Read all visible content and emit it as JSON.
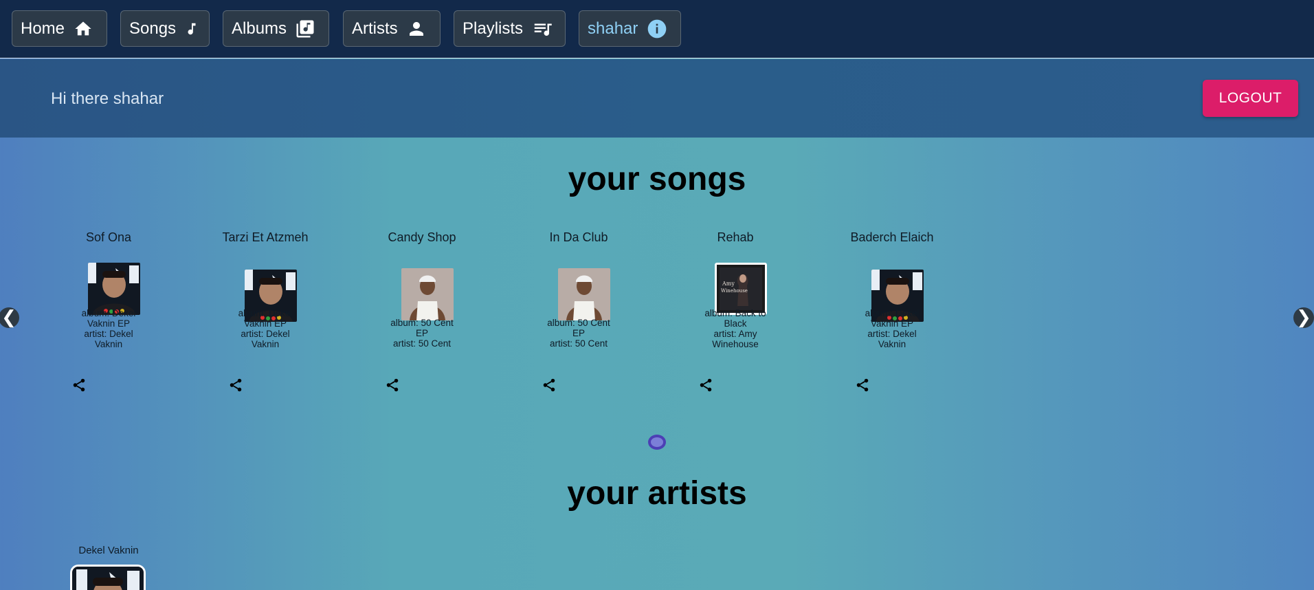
{
  "nav": {
    "items": [
      {
        "label": "Home",
        "icon": "home-icon"
      },
      {
        "label": "Songs",
        "icon": "music-note-icon"
      },
      {
        "label": "Albums",
        "icon": "library-music-icon"
      },
      {
        "label": "Artists",
        "icon": "person-icon"
      },
      {
        "label": "Playlists",
        "icon": "playlist-icon"
      },
      {
        "label": "shahar",
        "icon": "info-icon"
      }
    ]
  },
  "greeting": {
    "text": "Hi there shahar",
    "logout_label": "LOGOUT"
  },
  "songs_section": {
    "title": "your songs",
    "songs": [
      {
        "title": "Sof Ona",
        "album_line": "album:  Dekel Vaknin EP",
        "artist_line": "artist: Dekel Vaknin",
        "cover": "dekel-vaknin-cover"
      },
      {
        "title": "Tarzi Et Atzmeh",
        "album_line": "album:  Dekel Vaknin EP",
        "artist_line": "artist: Dekel Vaknin",
        "cover": "dekel-vaknin-cover"
      },
      {
        "title": "Candy Shop",
        "album_line": "album:  50 Cent EP",
        "artist_line": "artist: 50 Cent",
        "cover": "50-cent-cover"
      },
      {
        "title": "In Da Club",
        "album_line": "album:  50 Cent EP",
        "artist_line": "artist: 50 Cent",
        "cover": "50-cent-cover"
      },
      {
        "title": "Rehab",
        "album_line": "album:  Back to Black",
        "artist_line": "artist: Amy Winehouse",
        "cover": "back-to-black-cover"
      },
      {
        "title": "Baderch Elaich",
        "album_line": "album:  Dekel Vaknin EP",
        "artist_line": "artist: Dekel Vaknin",
        "cover": "dekel-vaknin-cover"
      }
    ],
    "prev_arrow": "❮",
    "next_arrow": "❯"
  },
  "artists_section": {
    "title": "your artists",
    "artists": [
      {
        "name": "Dekel Vaknin"
      }
    ]
  },
  "colors": {
    "nav_bg": "#12294a",
    "logout": "#dc1d69",
    "user_link": "#8fd0f5"
  }
}
